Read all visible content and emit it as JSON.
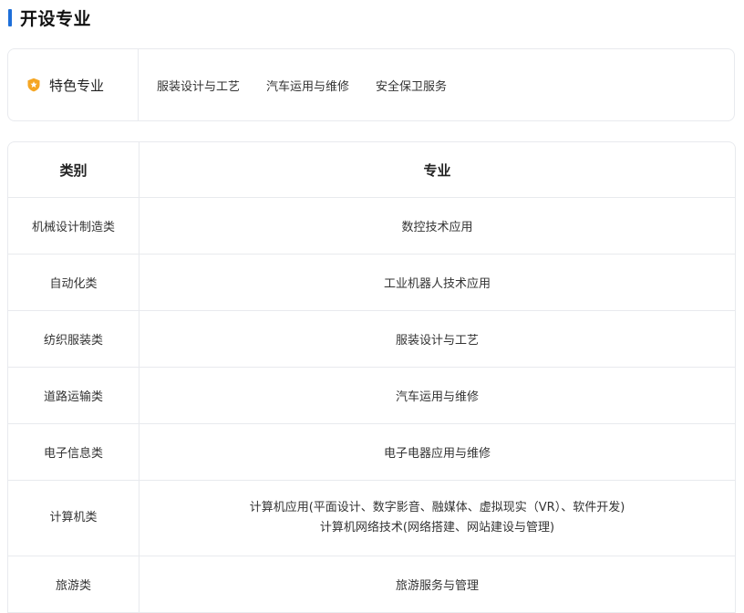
{
  "section": {
    "title": "开设专业"
  },
  "featured": {
    "icon": "star-badge-icon",
    "icon_color": "#f5a623",
    "label": "特色专业",
    "items": [
      "服装设计与工艺",
      "汽车运用与维修",
      "安全保卫服务"
    ]
  },
  "table": {
    "headers": {
      "category": "类别",
      "major": "专业"
    },
    "rows": [
      {
        "category": "机械设计制造类",
        "majors": [
          "数控技术应用"
        ]
      },
      {
        "category": "自动化类",
        "majors": [
          "工业机器人技术应用"
        ]
      },
      {
        "category": "纺织服装类",
        "majors": [
          "服装设计与工艺"
        ]
      },
      {
        "category": "道路运输类",
        "majors": [
          "汽车运用与维修"
        ]
      },
      {
        "category": "电子信息类",
        "majors": [
          "电子电器应用与维修"
        ]
      },
      {
        "category": "计算机类",
        "majors": [
          "计算机应用(平面设计、数字影音、融媒体、虚拟现实（VR）、软件开发)",
          "计算机网络技术(网络搭建、网站建设与管理)"
        ]
      },
      {
        "category": "旅游类",
        "majors": [
          "旅游服务与管理"
        ]
      }
    ]
  },
  "colors": {
    "accent": "#1e6fd9",
    "badge": "#f5a623",
    "border": "#e8eaee"
  }
}
